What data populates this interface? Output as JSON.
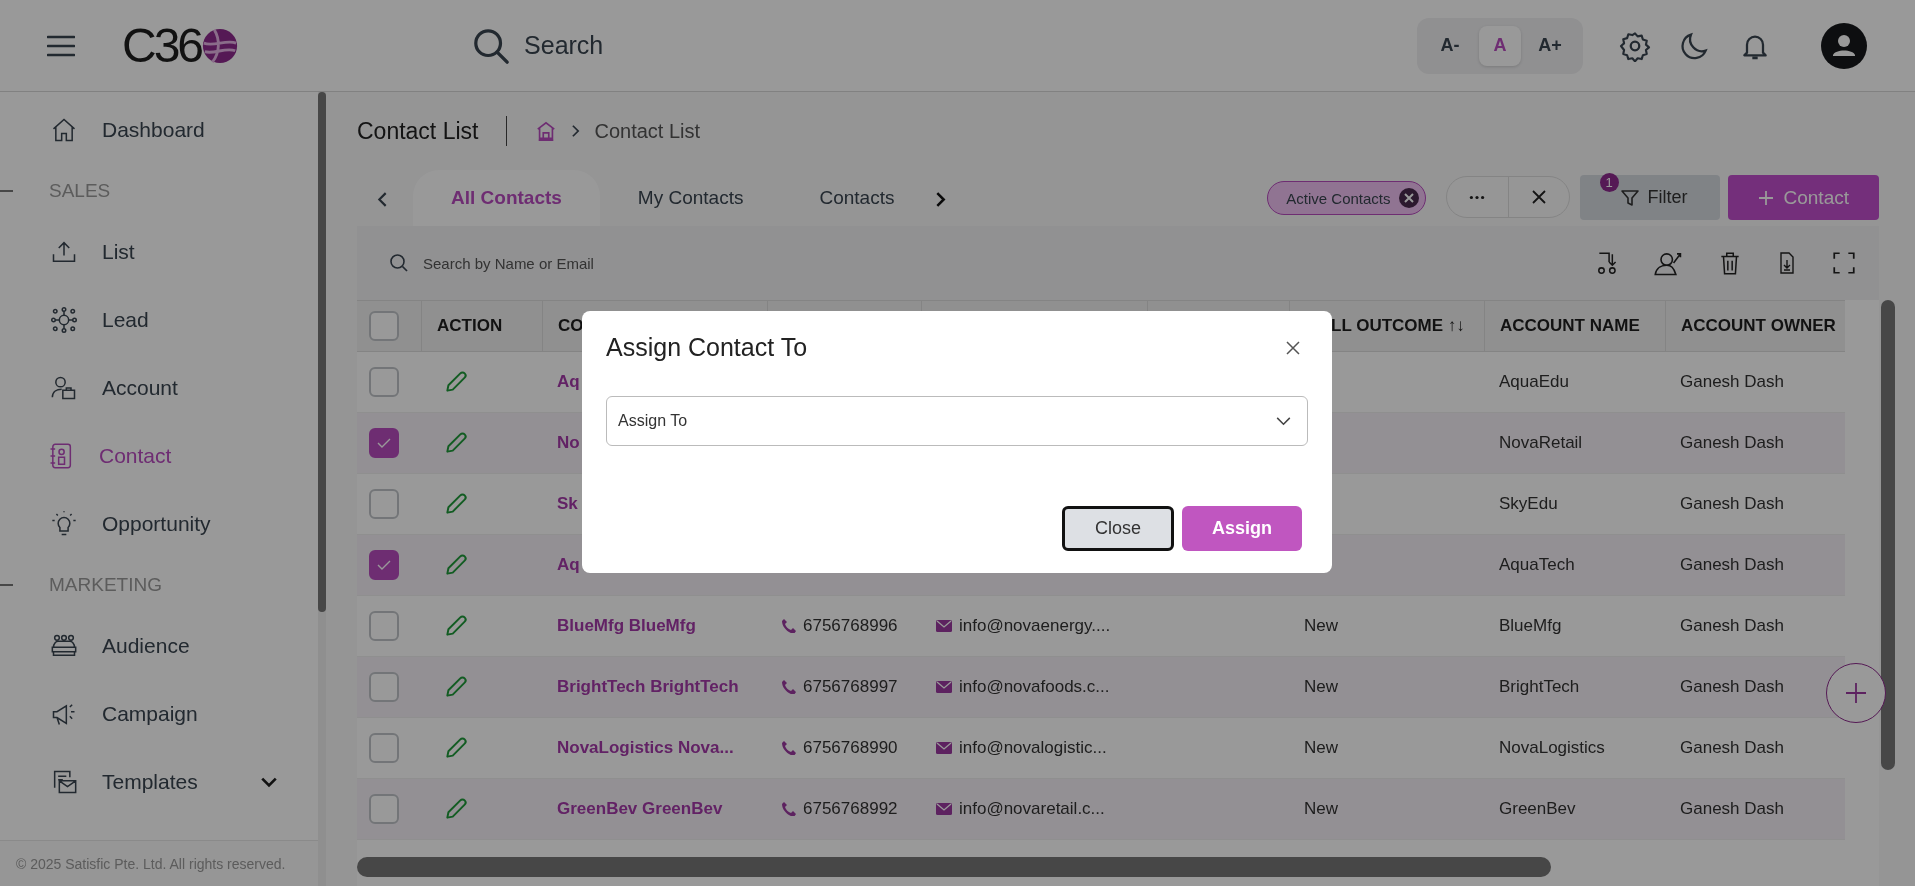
{
  "top_bar": {
    "logo": "C36",
    "search": {
      "label": "Search"
    },
    "font_sizes": [
      {
        "label": "A-",
        "selected": false
      },
      {
        "label": "A",
        "selected": true
      },
      {
        "label": "A+",
        "selected": false
      }
    ]
  },
  "sidebar": {
    "items": [
      {
        "kind": "link",
        "label": "Dashboard",
        "selected": false
      },
      {
        "kind": "heading",
        "label": "SALES"
      },
      {
        "kind": "link",
        "label": "List",
        "selected": false
      },
      {
        "kind": "link",
        "label": "Lead",
        "selected": false
      },
      {
        "kind": "link",
        "label": "Account",
        "selected": false
      },
      {
        "kind": "link",
        "label": "Contact",
        "selected": true
      },
      {
        "kind": "link",
        "label": "Opportunity",
        "selected": false
      },
      {
        "kind": "heading",
        "label": "MARKETING"
      },
      {
        "kind": "link",
        "label": "Audience",
        "selected": false
      },
      {
        "kind": "link",
        "label": "Campaign",
        "selected": false
      },
      {
        "kind": "group",
        "label": "Templates",
        "selected": false,
        "expanded": false
      }
    ],
    "footer": "© 2025 Satisfic Pte. Ltd. All rights reserved."
  },
  "page": {
    "title": "Contact List",
    "breadcrumb": "Contact List"
  },
  "tabs": [
    {
      "label": "All Contacts",
      "selected": true
    },
    {
      "label": "My Contacts",
      "selected": false
    },
    {
      "label": "Contacts",
      "selected": false
    }
  ],
  "active_filter": {
    "label": "Active Contacts"
  },
  "filter_button": {
    "label": "Filter",
    "badge": "1"
  },
  "add_button": {
    "label": "Contact"
  },
  "table": {
    "search_placeholder": "Search by Name or Email",
    "header_checked": false,
    "columns": {
      "action": "ACTION",
      "column_3": "CO",
      "column_7": "LL OUTCOME ↑↓",
      "account_name": "ACCOUNT NAME",
      "account_owner": "ACCOUNT OWNER"
    },
    "rows": [
      {
        "checked": false,
        "column_3": "Aq",
        "account_name": "AquaEdu",
        "account_owner": "Ganesh Dash"
      },
      {
        "checked": true,
        "column_3": "No",
        "account_name": "NovaRetail",
        "account_owner": "Ganesh Dash"
      },
      {
        "checked": false,
        "column_3": "Sk",
        "account_name": "SkyEdu",
        "account_owner": "Ganesh Dash"
      },
      {
        "checked": true,
        "column_3": "Aq",
        "account_name": "AquaTech",
        "account_owner": "Ganesh Dash"
      },
      {
        "checked": false,
        "column_3": "BlueMfg BlueMfg",
        "column_4": "6756768996",
        "column_5": "info@novaenergy....",
        "column_7": "New",
        "account_name": "BlueMfg",
        "account_owner": "Ganesh Dash"
      },
      {
        "checked": false,
        "column_3": "BrightTech BrightTech",
        "column_4": "6756768997",
        "column_5": "info@novafoods.c...",
        "column_7": "New",
        "account_name": "BrightTech",
        "account_owner": "Ganesh Dash"
      },
      {
        "checked": false,
        "column_3": "NovaLogistics Nova...",
        "column_4": "6756768990",
        "column_5": "info@novalogistic...",
        "column_7": "New",
        "account_name": "NovaLogistics",
        "account_owner": "Ganesh Dash"
      },
      {
        "checked": false,
        "column_3": "GreenBev GreenBev",
        "column_4": "6756768992",
        "column_5": "info@novaretail.c...",
        "column_7": "New",
        "account_name": "GreenBev",
        "account_owner": "Ganesh Dash"
      }
    ]
  },
  "modal": {
    "title": "Assign Contact To",
    "select": {
      "placeholder": "Assign To"
    },
    "buttons": [
      {
        "label": "Close",
        "kind": "secondary",
        "focused": true
      },
      {
        "label": "Assign",
        "kind": "primary",
        "focused": false
      }
    ]
  }
}
